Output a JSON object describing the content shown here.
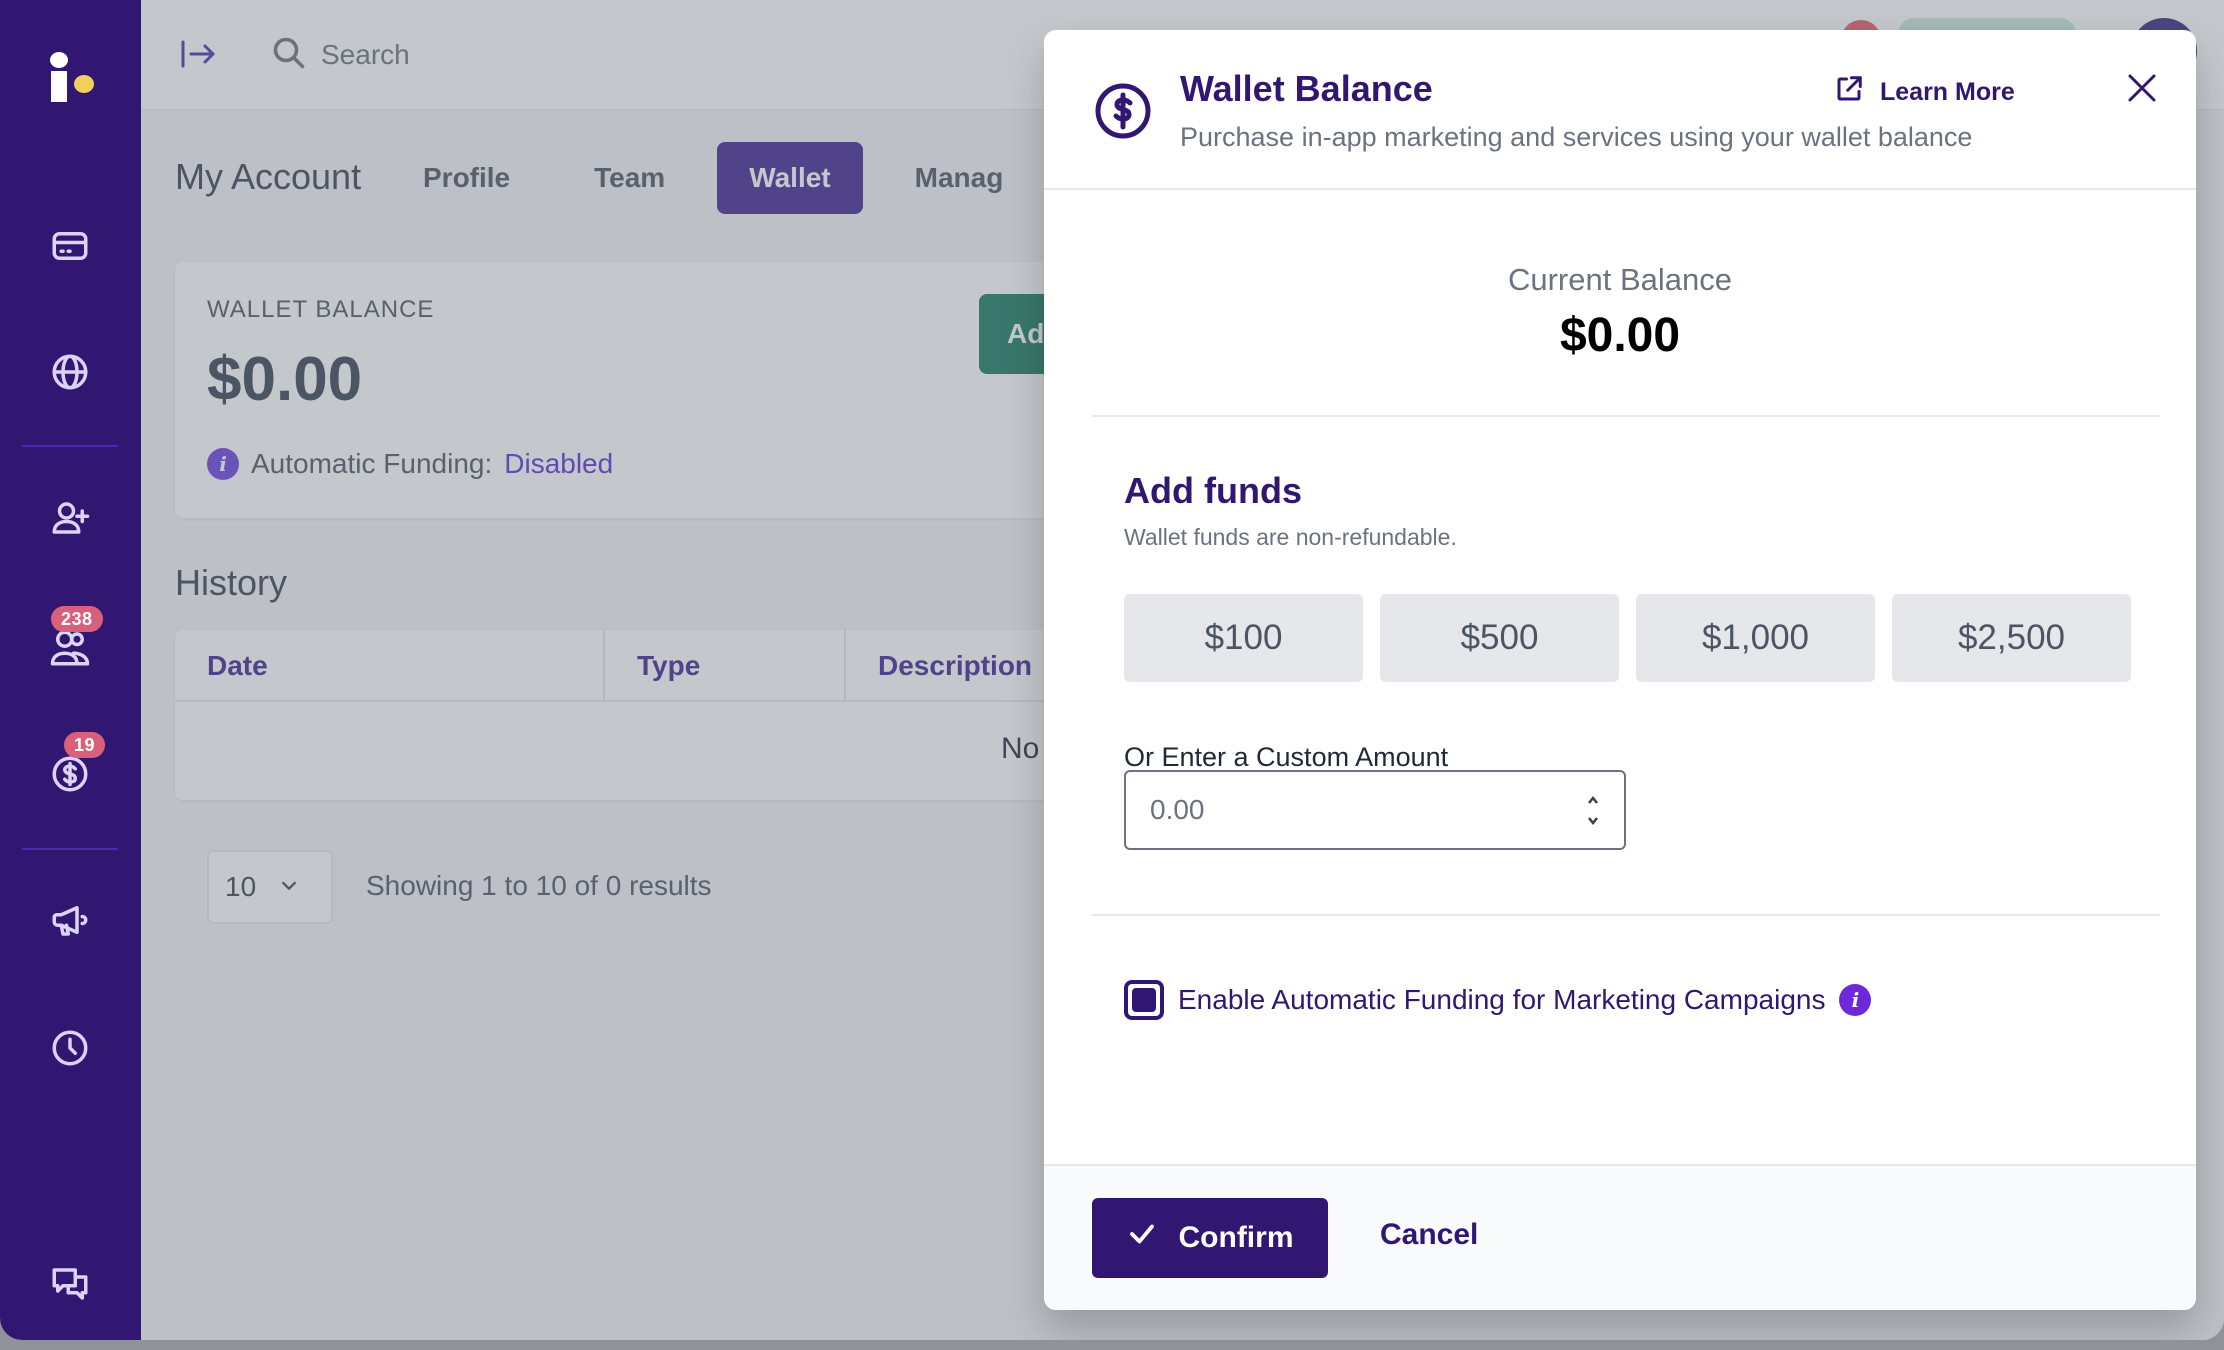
{
  "sidebar": {
    "logo": "i.",
    "items": [
      {
        "name": "billing",
        "icon": "credit-card-icon"
      },
      {
        "name": "web",
        "icon": "globe-icon"
      },
      {
        "name": "add-user",
        "icon": "user-plus-icon"
      },
      {
        "name": "contacts",
        "icon": "users-icon",
        "badge": "238"
      },
      {
        "name": "payments",
        "icon": "dollar-circle-icon",
        "badge": "19"
      },
      {
        "name": "marketing",
        "icon": "megaphone-icon"
      },
      {
        "name": "history",
        "icon": "clock-icon"
      },
      {
        "name": "chat",
        "icon": "chat-icon"
      }
    ]
  },
  "topbar": {
    "search_placeholder": "Search"
  },
  "page": {
    "title": "My Account",
    "tabs": [
      {
        "label": "Profile",
        "active": false
      },
      {
        "label": "Team",
        "active": false
      },
      {
        "label": "Wallet",
        "active": true
      },
      {
        "label": "Manag",
        "active": false
      }
    ],
    "wallet_card": {
      "label": "WALLET BALANCE",
      "value": "$0.00",
      "auto_label": "Automatic Funding:",
      "auto_status": "Disabled",
      "add_funds_button": "Add F"
    },
    "history": {
      "title": "History",
      "columns": [
        "Date",
        "Type",
        "Description"
      ],
      "empty_text": "No",
      "page_size": "10",
      "showing": "Showing 1 to 10 of 0 results"
    }
  },
  "modal": {
    "title": "Wallet Balance",
    "subtitle": "Purchase in-app marketing and services using your wallet balance",
    "learn_more": "Learn More",
    "current_balance_label": "Current Balance",
    "current_balance_value": "$0.00",
    "add_funds_title": "Add funds",
    "add_funds_note": "Wallet funds are non-refundable.",
    "presets": [
      "$100",
      "$500",
      "$1,000",
      "$2,500"
    ],
    "custom_label": "Or Enter a Custom Amount",
    "custom_placeholder": "0.00",
    "custom_value": "",
    "auto_funding_label": "Enable Automatic Funding for Marketing Campaigns",
    "auto_funding_checked": true,
    "confirm_label": "Confirm",
    "cancel_label": "Cancel"
  },
  "colors": {
    "brand": "#311672",
    "accent": "#6d28d9",
    "badge": "#d9607a",
    "logo_dot": "#f2cf5b"
  }
}
